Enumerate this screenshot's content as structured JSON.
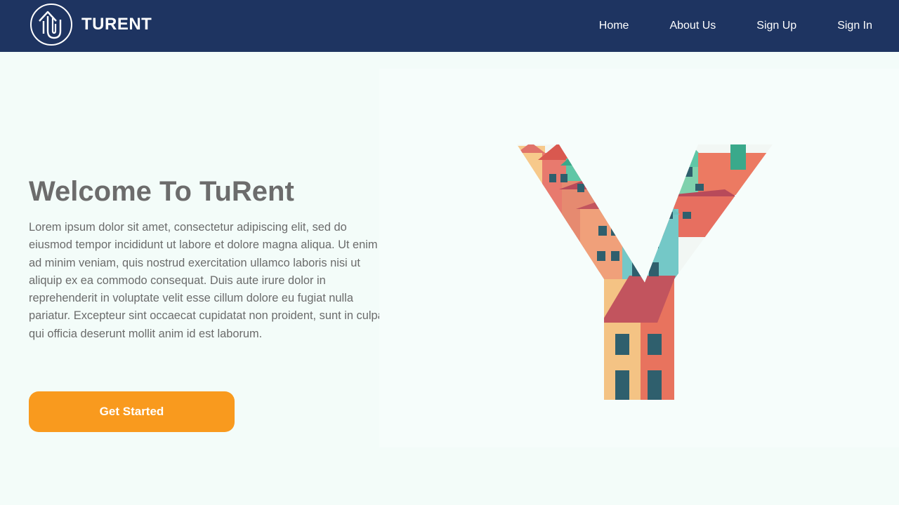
{
  "brand": {
    "name": "TURENT",
    "logo_icon": "house-key-logo-icon"
  },
  "nav": {
    "items": [
      "Home",
      "About Us",
      "Sign Up",
      "Sign In"
    ]
  },
  "hero": {
    "title": "Welcome To TuRent",
    "body": "Lorem ipsum dolor sit amet, consectetur adipiscing elit, sed do eiusmod tempor incididunt ut labore et dolore magna aliqua. Ut enim ad minim veniam, quis nostrud exercitation ullamco laboris nisi ut aliquip ex ea commodo consequat. Duis aute irure dolor in reprehenderit in voluptate velit esse cillum dolore eu fugiat nulla pariatur. Excepteur sint occaecat cupidatat non proident, sunt in culpa qui officia deserunt mollit anim id est laborum.",
    "cta_label": "Get Started"
  },
  "colors": {
    "navbar": "#1e3461",
    "accent": "#f99a1e",
    "background": "#f3fcf9"
  }
}
